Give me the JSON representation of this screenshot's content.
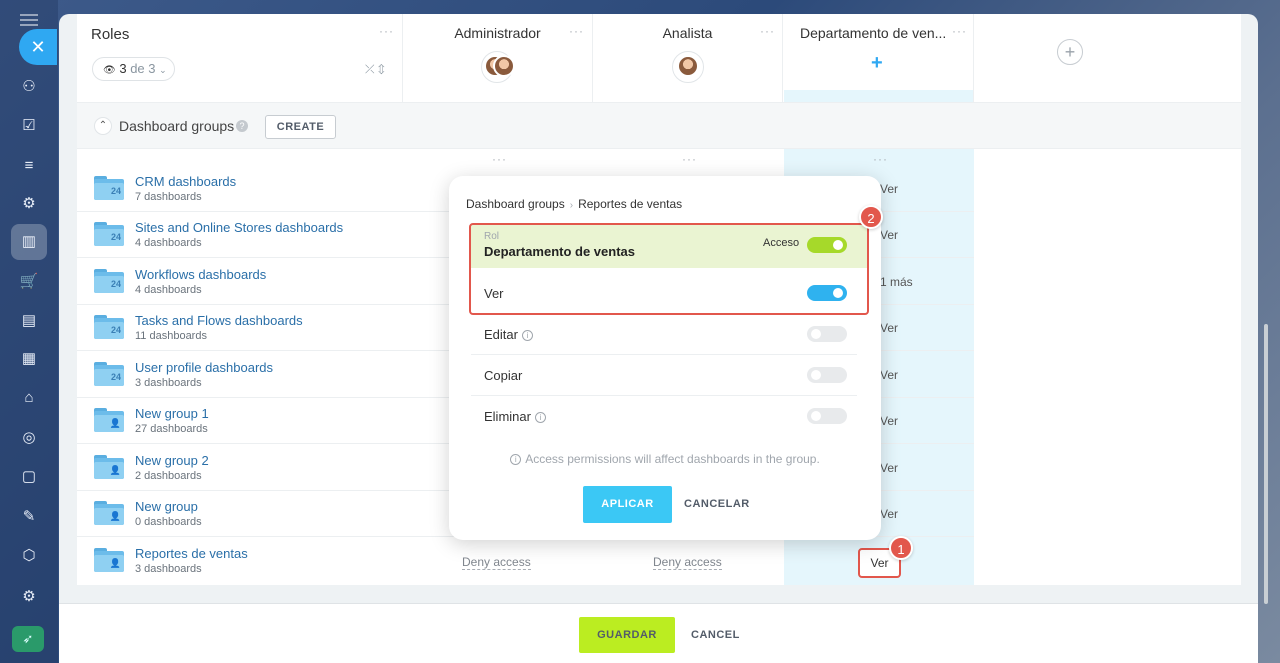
{
  "sidebar": {
    "icons": [
      "menu-icon",
      "close-icon",
      "sites-icon",
      "tasks-icon",
      "filter-icon",
      "robot-icon",
      "analytics-icon",
      "cart-icon",
      "contact-center-icon",
      "calendar-icon",
      "store-icon",
      "target-icon",
      "document-icon",
      "sign-icon",
      "box-icon",
      "settings-icon",
      "rocket-icon"
    ]
  },
  "header": {
    "roles_title": "Roles",
    "roles_count": "3",
    "roles_of": "de 3",
    "columns": [
      {
        "title": "Administrador"
      },
      {
        "title": "Analista"
      },
      {
        "title": "Departamento de ven..."
      }
    ]
  },
  "section": {
    "title": "Dashboard groups",
    "create_label": "CREATE"
  },
  "groups": [
    {
      "name": "CRM dashboards",
      "count": "7 dashboards",
      "icon": "24",
      "col3": "Ver"
    },
    {
      "name": "Sites and Online Stores dashboards",
      "count": "4 dashboards",
      "icon": "24",
      "col3": "Ver"
    },
    {
      "name": "Workflows dashboards",
      "count": "4 dashboards",
      "icon": "24",
      "col3": "1 más"
    },
    {
      "name": "Tasks and Flows dashboards",
      "count": "11 dashboards",
      "icon": "24",
      "col3": "Ver"
    },
    {
      "name": "User profile dashboards",
      "count": "3 dashboards",
      "icon": "24",
      "col3": "Ver"
    },
    {
      "name": "New group 1",
      "count": "27 dashboards",
      "icon": "user",
      "col3": "Ver"
    },
    {
      "name": "New group 2",
      "count": "2 dashboards",
      "icon": "user",
      "col3": "Ver"
    },
    {
      "name": "New group",
      "count": "0 dashboards",
      "icon": "user",
      "col3": "Ver"
    },
    {
      "name": "Reportes de ventas",
      "count": "3 dashboards",
      "icon": "user",
      "col1": "Deny access",
      "col2": "Deny access",
      "col3": "Ver"
    }
  ],
  "popup": {
    "crumb_parent": "Dashboard groups",
    "crumb_current": "Reportes de ventas",
    "rol_label": "Rol",
    "rol_name": "Departamento de ventas",
    "acceso_label": "Acceso",
    "permissions": [
      {
        "label": "Ver",
        "on": true
      },
      {
        "label": "Editar",
        "on": false
      },
      {
        "label": "Copiar",
        "on": false
      },
      {
        "label": "Eliminar",
        "on": false
      }
    ],
    "note": "Access permissions will affect dashboards in the group.",
    "apply_label": "APLICAR",
    "cancel_label": "CANCELAR"
  },
  "callouts": {
    "one": "1",
    "two": "2"
  },
  "footer": {
    "save_label": "GUARDAR",
    "cancel_label": "CANCEL"
  },
  "colors": {
    "accent": "#2fa8f2",
    "save": "#bbed21",
    "highlight": "#e2574c",
    "toggle_green": "#a6d92a",
    "toggle_blue": "#2fb2ef"
  }
}
